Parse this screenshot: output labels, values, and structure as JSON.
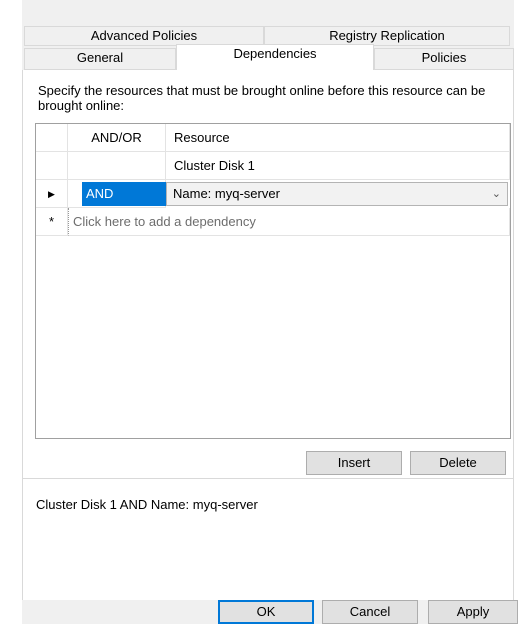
{
  "tabs": {
    "row1": [
      "Advanced Policies",
      "Registry Replication"
    ],
    "row2": [
      "General",
      "Dependencies",
      "Policies"
    ]
  },
  "instructions": "Specify the resources that must be brought online before this resource can be brought online:",
  "grid": {
    "columns": [
      "AND/OR",
      "Resource"
    ],
    "rows": [
      {
        "andor": "",
        "resource": "Cluster Disk 1"
      },
      {
        "andor": "AND",
        "resource": "Name: myq-server"
      }
    ],
    "new_row_placeholder": "Click here to add a dependency"
  },
  "buttons": {
    "insert": "Insert",
    "delete": "Delete",
    "ok": "OK",
    "cancel": "Cancel",
    "apply": "Apply"
  },
  "summary": "Cluster Disk 1 AND Name: myq-server",
  "colors": {
    "selection": "#0078d7"
  }
}
